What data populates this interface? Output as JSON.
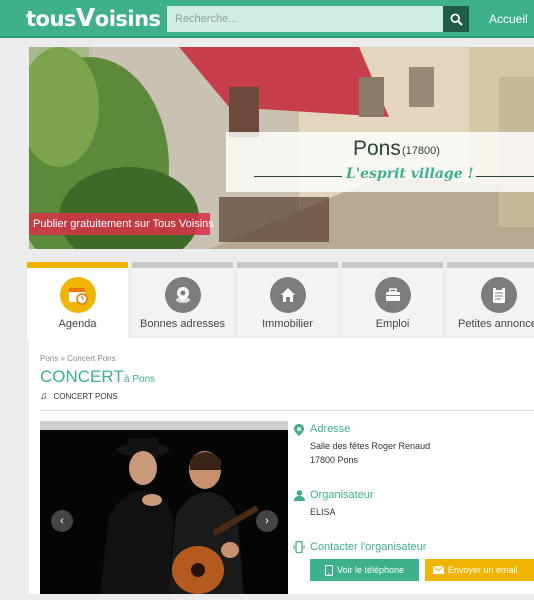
{
  "header": {
    "logo_text_1": "tous",
    "logo_mark": "V",
    "logo_text_2": "oisins",
    "search_placeholder": "Recherche...",
    "search_icon": "search-icon",
    "nav_home": "Accueil",
    "accent_color": "#3eb08b"
  },
  "hero": {
    "city": "Pons",
    "postal_code": "(17800)",
    "slogan": "L'esprit village !",
    "cta": "Publier gratuitement sur Tous Voisins"
  },
  "categories": [
    {
      "label": "Agenda",
      "icon": "calendar-icon",
      "active": true
    },
    {
      "label": "Bonnes adresses",
      "icon": "map-pin-icon",
      "active": false
    },
    {
      "label": "Immobilier",
      "icon": "house-icon",
      "active": false
    },
    {
      "label": "Emploi",
      "icon": "briefcase-icon",
      "active": false
    },
    {
      "label": "Petites annonces",
      "icon": "clipboard-icon",
      "active": false
    }
  ],
  "breadcrumb": "Pons » Concert Pons",
  "event": {
    "title": "CONCERT",
    "place": "à Pons",
    "subtitle": "CONCERT PONS"
  },
  "details": {
    "address_heading": "Adresse",
    "address_line1": "Salle des fêtes Roger Renaud",
    "address_line2": "17800 Pons",
    "organizer_heading": "Organisateur",
    "organizer_name": "ELISA",
    "contact_heading": "Contacter l'organisateur",
    "phone_button": "Voir le téléphone",
    "email_button": "Envoyer un email"
  }
}
